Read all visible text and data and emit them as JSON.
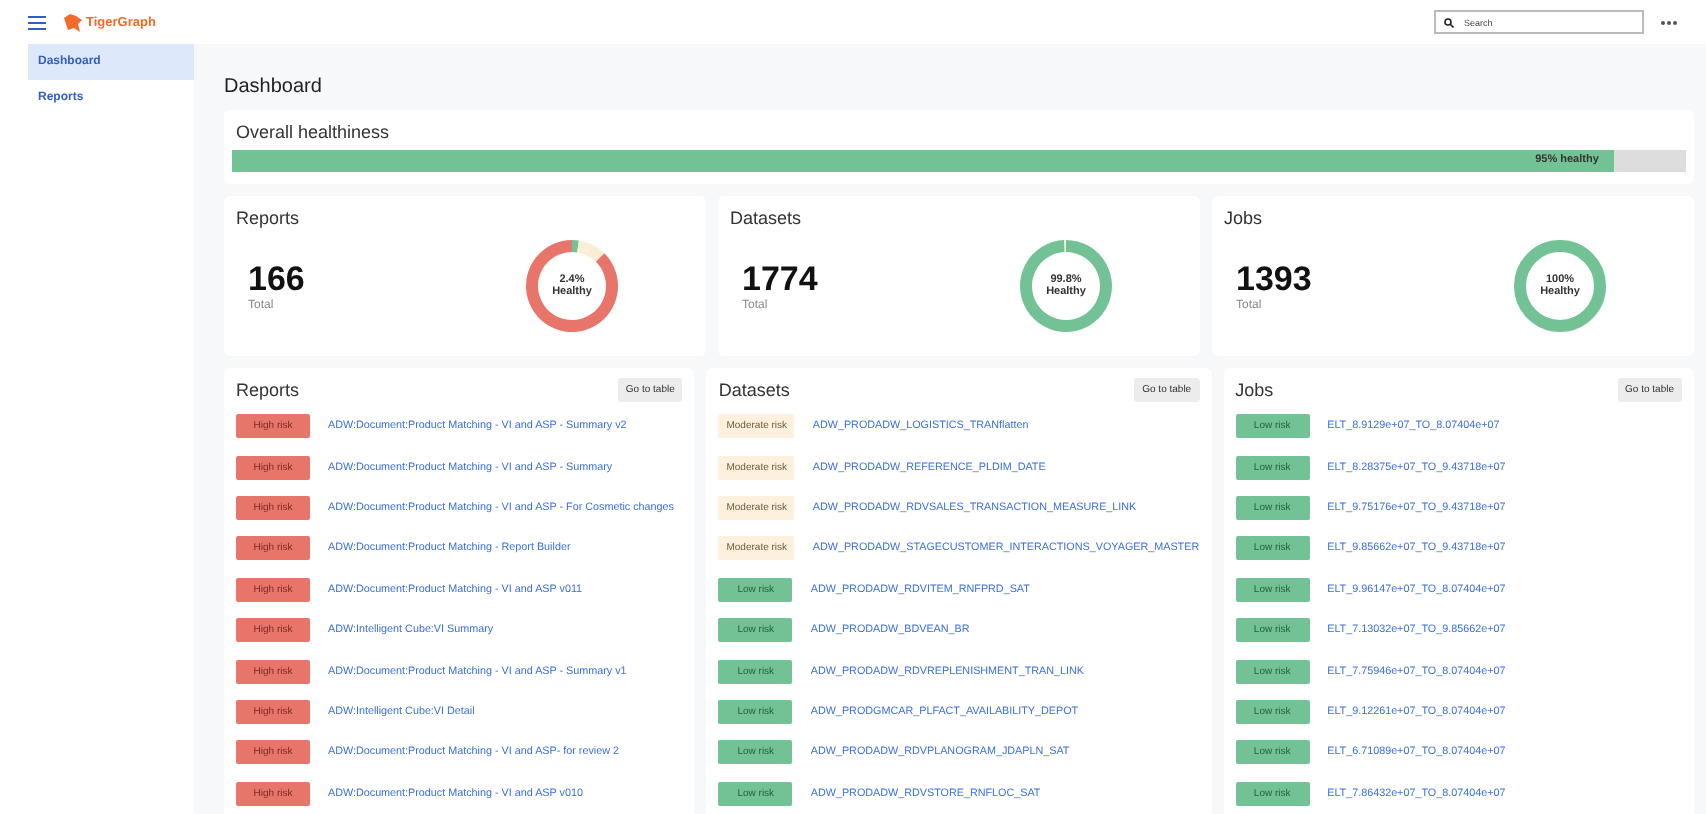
{
  "header": {
    "brand": "TigerGraph",
    "search": {
      "placeholder": "Search"
    }
  },
  "sidebar": {
    "items": [
      {
        "label": "Dashboard",
        "selected": true
      },
      {
        "label": "Reports",
        "selected": false
      }
    ]
  },
  "page_title": "Dashboard",
  "overall": {
    "title": "Overall healthiness",
    "level": 0.95,
    "label": "95% healthy"
  },
  "summaries": [
    {
      "title": "Reports",
      "count": "166",
      "count_label": "Total",
      "donut_label": "2.4%",
      "donut_sublabel": "Healthy",
      "chart_data": {
        "type": "donut",
        "values": [
          2.4,
          10,
          87.6
        ]
      }
    },
    {
      "title": "Datasets",
      "count": "1774",
      "count_label": "Total",
      "donut_label": "99.8%",
      "donut_sublabel": "Healthy",
      "chart_data": {
        "type": "donut",
        "values": [
          99.8,
          0.2
        ]
      }
    },
    {
      "title": "Jobs",
      "count": "1393",
      "count_label": "Total",
      "donut_label": "100%",
      "donut_sublabel": "Healthy"
    }
  ],
  "lists": [
    {
      "title": "Reports",
      "button": "Go to table",
      "rows": [
        {
          "kind": "high",
          "risk": "High risk",
          "name": "ADW:Document:Product Matching - VI and ASP - Summary v2"
        },
        {
          "kind": "high",
          "risk": "High risk",
          "name": "ADW:Document:Product Matching - VI and ASP - Summary"
        },
        {
          "kind": "high",
          "risk": "High risk",
          "name": "ADW:Document:Product Matching - VI and ASP - For Cosmetic changes"
        },
        {
          "kind": "high",
          "risk": "High risk",
          "name": "ADW:Document:Product Matching - Report Builder"
        },
        {
          "kind": "high",
          "risk": "High risk",
          "name": "ADW:Document:Product Matching - VI and ASP v011"
        },
        {
          "kind": "high",
          "risk": "High risk",
          "name": "ADW:Intelligent Cube:VI Summary"
        },
        {
          "kind": "high",
          "risk": "High risk",
          "name": "ADW:Document:Product Matching - VI and ASP - Summary v1"
        },
        {
          "kind": "high",
          "risk": "High risk",
          "name": "ADW:Intelligent Cube:VI Detail"
        },
        {
          "kind": "high",
          "risk": "High risk",
          "name": "ADW:Document:Product Matching - VI and ASP- for review 2"
        },
        {
          "kind": "high",
          "risk": "High risk",
          "name": "ADW:Document:Product Matching - VI and ASP v010"
        }
      ]
    },
    {
      "title": "Datasets",
      "button": "Go to table",
      "rows": [
        {
          "kind": "moderate",
          "risk": "Moderate risk",
          "name": "ADW_PRODADW_LOGISTICS_TRANflatten"
        },
        {
          "kind": "moderate",
          "risk": "Moderate risk",
          "name": "ADW_PRODADW_REFERENCE_PLDIM_DATE"
        },
        {
          "kind": "moderate",
          "risk": "Moderate risk",
          "name": "ADW_PRODADW_RDVSALES_TRANSACTION_MEASURE_LINK"
        },
        {
          "kind": "moderate",
          "risk": "Moderate risk",
          "name": "ADW_PRODADW_STAGECUSTOMER_INTERACTIONS_VOYAGER_MASTER"
        },
        {
          "kind": "low",
          "risk": "Low risk",
          "name": "ADW_PRODADW_RDVITEM_RNFPRD_SAT"
        },
        {
          "kind": "low",
          "risk": "Low risk",
          "name": "ADW_PRODADW_BDVEAN_BR"
        },
        {
          "kind": "low",
          "risk": "Low risk",
          "name": "ADW_PRODADW_RDVREPLENISHMENT_TRAN_LINK"
        },
        {
          "kind": "low",
          "risk": "Low risk",
          "name": "ADW_PRODGMCAR_PLFACT_AVAILABILITY_DEPOT"
        },
        {
          "kind": "low",
          "risk": "Low risk",
          "name": "ADW_PRODADW_RDVPLANOGRAM_JDAPLN_SAT"
        },
        {
          "kind": "low",
          "risk": "Low risk",
          "name": "ADW_PRODADW_RDVSTORE_RNFLOC_SAT"
        }
      ]
    },
    {
      "title": "Jobs",
      "button": "Go to table",
      "rows": [
        {
          "kind": "low",
          "risk": "Low risk",
          "name": "ELT_8.9129e+07_TO_8.07404e+07"
        },
        {
          "kind": "low",
          "risk": "Low risk",
          "name": "ELT_8.28375e+07_TO_9.43718e+07"
        },
        {
          "kind": "low",
          "risk": "Low risk",
          "name": "ELT_9.75176e+07_TO_9.43718e+07"
        },
        {
          "kind": "low",
          "risk": "Low risk",
          "name": "ELT_9.85662e+07_TO_9.43718e+07"
        },
        {
          "kind": "low",
          "risk": "Low risk",
          "name": "ELT_9.96147e+07_TO_8.07404e+07"
        },
        {
          "kind": "low",
          "risk": "Low risk",
          "name": "ELT_7.13032e+07_TO_9.85662e+07"
        },
        {
          "kind": "low",
          "risk": "Low risk",
          "name": "ELT_7.75946e+07_TO_8.07404e+07"
        },
        {
          "kind": "low",
          "risk": "Low risk",
          "name": "ELT_9.12261e+07_TO_8.07404e+07"
        },
        {
          "kind": "low",
          "risk": "Low risk",
          "name": "ELT_6.71089e+07_TO_8.07404e+07"
        },
        {
          "kind": "low",
          "risk": "Low risk",
          "name": "ELT_7.86432e+07_TO_8.07404e+07"
        }
      ]
    }
  ]
}
